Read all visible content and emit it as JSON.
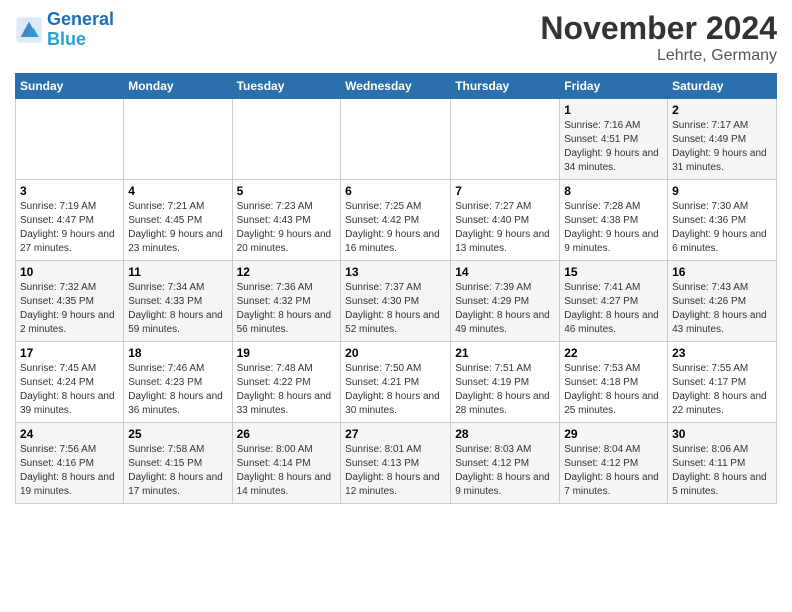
{
  "header": {
    "logo_line1": "General",
    "logo_line2": "Blue",
    "month": "November 2024",
    "location": "Lehrte, Germany"
  },
  "days_of_week": [
    "Sunday",
    "Monday",
    "Tuesday",
    "Wednesday",
    "Thursday",
    "Friday",
    "Saturday"
  ],
  "weeks": [
    [
      {
        "day": "",
        "sunrise": "",
        "sunset": "",
        "daylight": ""
      },
      {
        "day": "",
        "sunrise": "",
        "sunset": "",
        "daylight": ""
      },
      {
        "day": "",
        "sunrise": "",
        "sunset": "",
        "daylight": ""
      },
      {
        "day": "",
        "sunrise": "",
        "sunset": "",
        "daylight": ""
      },
      {
        "day": "",
        "sunrise": "",
        "sunset": "",
        "daylight": ""
      },
      {
        "day": "1",
        "sunrise": "Sunrise: 7:16 AM",
        "sunset": "Sunset: 4:51 PM",
        "daylight": "Daylight: 9 hours and 34 minutes."
      },
      {
        "day": "2",
        "sunrise": "Sunrise: 7:17 AM",
        "sunset": "Sunset: 4:49 PM",
        "daylight": "Daylight: 9 hours and 31 minutes."
      }
    ],
    [
      {
        "day": "3",
        "sunrise": "Sunrise: 7:19 AM",
        "sunset": "Sunset: 4:47 PM",
        "daylight": "Daylight: 9 hours and 27 minutes."
      },
      {
        "day": "4",
        "sunrise": "Sunrise: 7:21 AM",
        "sunset": "Sunset: 4:45 PM",
        "daylight": "Daylight: 9 hours and 23 minutes."
      },
      {
        "day": "5",
        "sunrise": "Sunrise: 7:23 AM",
        "sunset": "Sunset: 4:43 PM",
        "daylight": "Daylight: 9 hours and 20 minutes."
      },
      {
        "day": "6",
        "sunrise": "Sunrise: 7:25 AM",
        "sunset": "Sunset: 4:42 PM",
        "daylight": "Daylight: 9 hours and 16 minutes."
      },
      {
        "day": "7",
        "sunrise": "Sunrise: 7:27 AM",
        "sunset": "Sunset: 4:40 PM",
        "daylight": "Daylight: 9 hours and 13 minutes."
      },
      {
        "day": "8",
        "sunrise": "Sunrise: 7:28 AM",
        "sunset": "Sunset: 4:38 PM",
        "daylight": "Daylight: 9 hours and 9 minutes."
      },
      {
        "day": "9",
        "sunrise": "Sunrise: 7:30 AM",
        "sunset": "Sunset: 4:36 PM",
        "daylight": "Daylight: 9 hours and 6 minutes."
      }
    ],
    [
      {
        "day": "10",
        "sunrise": "Sunrise: 7:32 AM",
        "sunset": "Sunset: 4:35 PM",
        "daylight": "Daylight: 9 hours and 2 minutes."
      },
      {
        "day": "11",
        "sunrise": "Sunrise: 7:34 AM",
        "sunset": "Sunset: 4:33 PM",
        "daylight": "Daylight: 8 hours and 59 minutes."
      },
      {
        "day": "12",
        "sunrise": "Sunrise: 7:36 AM",
        "sunset": "Sunset: 4:32 PM",
        "daylight": "Daylight: 8 hours and 56 minutes."
      },
      {
        "day": "13",
        "sunrise": "Sunrise: 7:37 AM",
        "sunset": "Sunset: 4:30 PM",
        "daylight": "Daylight: 8 hours and 52 minutes."
      },
      {
        "day": "14",
        "sunrise": "Sunrise: 7:39 AM",
        "sunset": "Sunset: 4:29 PM",
        "daylight": "Daylight: 8 hours and 49 minutes."
      },
      {
        "day": "15",
        "sunrise": "Sunrise: 7:41 AM",
        "sunset": "Sunset: 4:27 PM",
        "daylight": "Daylight: 8 hours and 46 minutes."
      },
      {
        "day": "16",
        "sunrise": "Sunrise: 7:43 AM",
        "sunset": "Sunset: 4:26 PM",
        "daylight": "Daylight: 8 hours and 43 minutes."
      }
    ],
    [
      {
        "day": "17",
        "sunrise": "Sunrise: 7:45 AM",
        "sunset": "Sunset: 4:24 PM",
        "daylight": "Daylight: 8 hours and 39 minutes."
      },
      {
        "day": "18",
        "sunrise": "Sunrise: 7:46 AM",
        "sunset": "Sunset: 4:23 PM",
        "daylight": "Daylight: 8 hours and 36 minutes."
      },
      {
        "day": "19",
        "sunrise": "Sunrise: 7:48 AM",
        "sunset": "Sunset: 4:22 PM",
        "daylight": "Daylight: 8 hours and 33 minutes."
      },
      {
        "day": "20",
        "sunrise": "Sunrise: 7:50 AM",
        "sunset": "Sunset: 4:21 PM",
        "daylight": "Daylight: 8 hours and 30 minutes."
      },
      {
        "day": "21",
        "sunrise": "Sunrise: 7:51 AM",
        "sunset": "Sunset: 4:19 PM",
        "daylight": "Daylight: 8 hours and 28 minutes."
      },
      {
        "day": "22",
        "sunrise": "Sunrise: 7:53 AM",
        "sunset": "Sunset: 4:18 PM",
        "daylight": "Daylight: 8 hours and 25 minutes."
      },
      {
        "day": "23",
        "sunrise": "Sunrise: 7:55 AM",
        "sunset": "Sunset: 4:17 PM",
        "daylight": "Daylight: 8 hours and 22 minutes."
      }
    ],
    [
      {
        "day": "24",
        "sunrise": "Sunrise: 7:56 AM",
        "sunset": "Sunset: 4:16 PM",
        "daylight": "Daylight: 8 hours and 19 minutes."
      },
      {
        "day": "25",
        "sunrise": "Sunrise: 7:58 AM",
        "sunset": "Sunset: 4:15 PM",
        "daylight": "Daylight: 8 hours and 17 minutes."
      },
      {
        "day": "26",
        "sunrise": "Sunrise: 8:00 AM",
        "sunset": "Sunset: 4:14 PM",
        "daylight": "Daylight: 8 hours and 14 minutes."
      },
      {
        "day": "27",
        "sunrise": "Sunrise: 8:01 AM",
        "sunset": "Sunset: 4:13 PM",
        "daylight": "Daylight: 8 hours and 12 minutes."
      },
      {
        "day": "28",
        "sunrise": "Sunrise: 8:03 AM",
        "sunset": "Sunset: 4:12 PM",
        "daylight": "Daylight: 8 hours and 9 minutes."
      },
      {
        "day": "29",
        "sunrise": "Sunrise: 8:04 AM",
        "sunset": "Sunset: 4:12 PM",
        "daylight": "Daylight: 8 hours and 7 minutes."
      },
      {
        "day": "30",
        "sunrise": "Sunrise: 8:06 AM",
        "sunset": "Sunset: 4:11 PM",
        "daylight": "Daylight: 8 hours and 5 minutes."
      }
    ]
  ]
}
